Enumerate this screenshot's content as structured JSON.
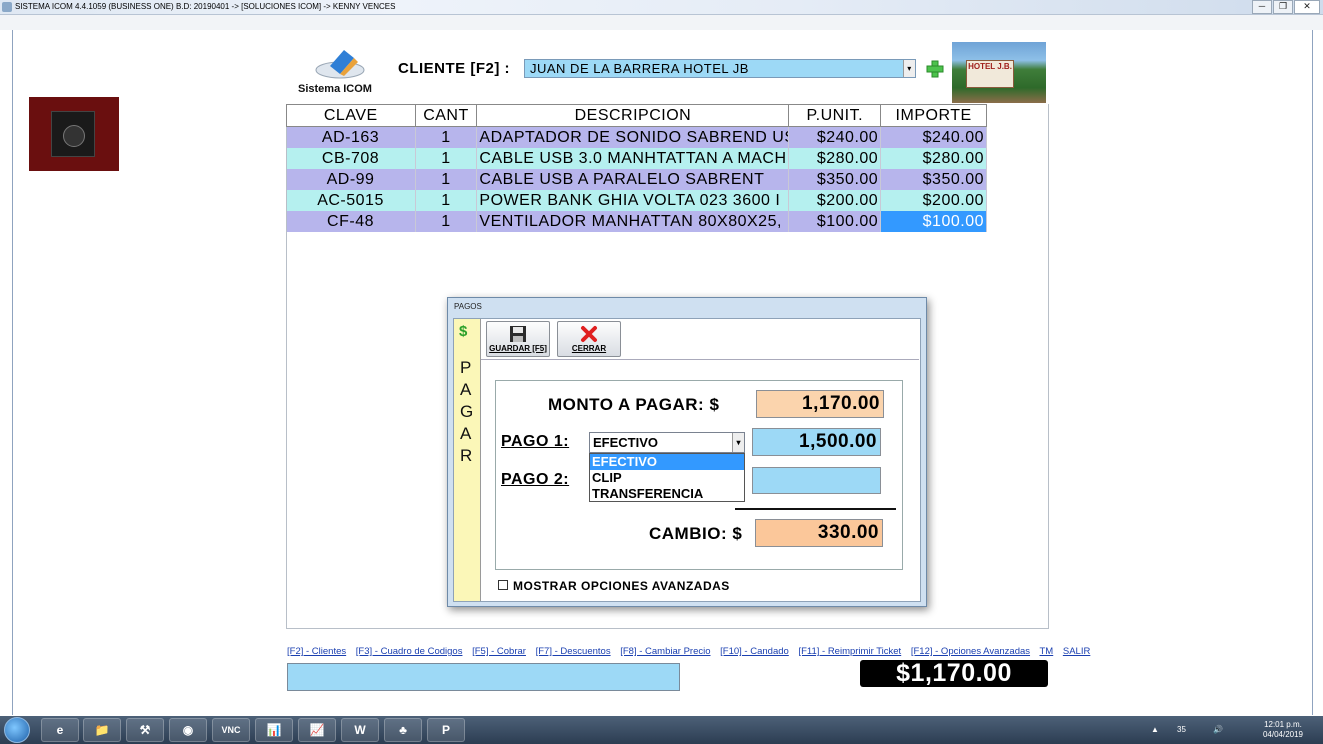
{
  "window": {
    "title": "SISTEMA ICOM 4.4.1059 (BUSINESS ONE)  B.D: 20190401  ->  [SOLUCIONES ICOM]  ->  KENNY VENCES",
    "min": "─",
    "max": "❐",
    "close": "✕"
  },
  "header": {
    "logo_text": "Sistema ICOM",
    "cliente_label": "CLIENTE  [F2] :",
    "cliente_value": "JUAN DE LA BARRERA HOTEL JB",
    "hotel_sign": "HOTEL J.B."
  },
  "grid": {
    "columns": [
      "CLAVE",
      "CANT",
      "DESCRIPCION",
      "P.UNIT.",
      "IMPORTE"
    ],
    "rows": [
      {
        "clave": "AD-163",
        "cant": "1",
        "desc": "ADAPTADOR DE SONIDO SABREND US",
        "punit": "$240.00",
        "importe": "$240.00"
      },
      {
        "clave": "CB-708",
        "cant": "1",
        "desc": "CABLE USB 3.0 MANHTATTAN A MACH",
        "punit": "$280.00",
        "importe": "$280.00"
      },
      {
        "clave": "AD-99",
        "cant": "1",
        "desc": "CABLE USB A PARALELO SABRENT",
        "punit": "$350.00",
        "importe": "$350.00"
      },
      {
        "clave": "AC-5015",
        "cant": "1",
        "desc": "POWER BANK GHIA VOLTA 023 3600 I",
        "punit": "$200.00",
        "importe": "$200.00"
      },
      {
        "clave": "CF-48",
        "cant": "1",
        "desc": "VENTILADOR MANHATTAN 80X80X25,",
        "punit": "$100.00",
        "importe": "$100.00"
      }
    ]
  },
  "dialog": {
    "title": "PAGOS",
    "side_word": "PAGAR",
    "dollar_icon": "$",
    "guardar_label": "GUARDAR  [F5]",
    "cerrar_label": "CERRAR",
    "monto_label": "MONTO A PAGAR: $",
    "monto_value": "1,170.00",
    "pago1_label": "PAGO 1:",
    "pago1_method": "EFECTIVO",
    "pago1_value": "1,500.00",
    "pago1_options": [
      "EFECTIVO",
      "CLIP",
      "TRANSFERENCIA"
    ],
    "pago2_label": "PAGO 2:",
    "pago2_value": "",
    "cambio_label": "CAMBIO: $",
    "cambio_value": "330.00",
    "advanced_label": "MOSTRAR OPCIONES AVANZADAS"
  },
  "footer": {
    "links": [
      "[F2] - Clientes",
      "[F3] - Cuadro de Codigos",
      "[F5] - Cobrar",
      "[F7] - Descuentos",
      "[F8] - Cambiar Precio",
      "[F10] - Candado",
      "[F11] - Reimprimir Ticket",
      "[F12] - Opciones Avanzadas",
      "TM",
      "SALIR"
    ],
    "status_text": "",
    "total": "$1,170.00"
  },
  "taskbar": {
    "apps": [
      "e",
      "📁",
      "⚒",
      "◉",
      "VNC",
      "📊",
      "📈",
      "W",
      "♣",
      "P"
    ],
    "tray_number": "35",
    "time": "12:01 p.m.",
    "date": "04/04/2019"
  },
  "colors": {
    "row_odd": "#b7b5ec",
    "row_even": "#b5f0ef",
    "selected": "#3399ff",
    "amount_peach": "#fbd4ad",
    "amount_blue": "#9dd9f6",
    "side_strip": "#fbf7b8"
  }
}
